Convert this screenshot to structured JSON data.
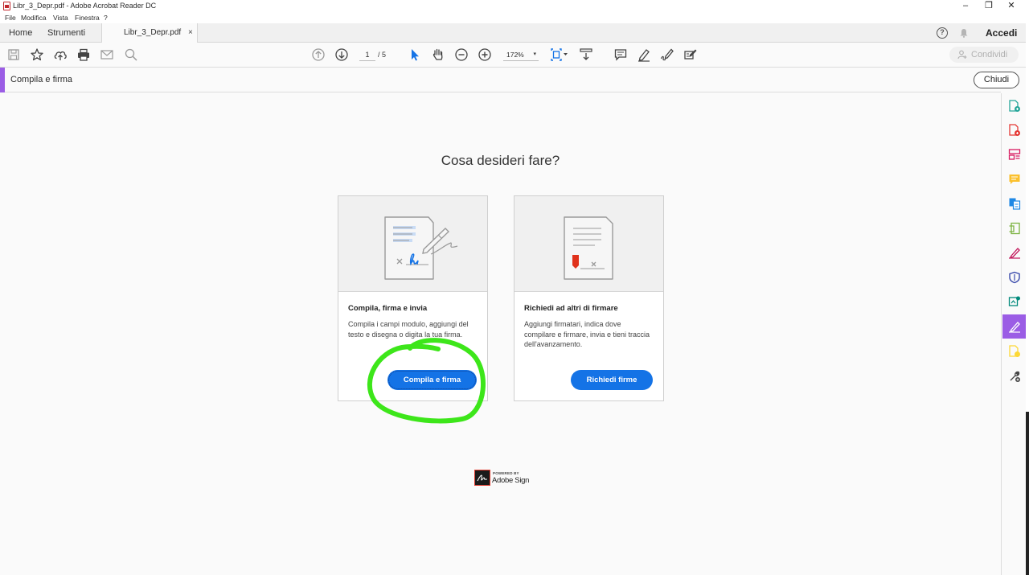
{
  "window": {
    "title": "Libr_3_Depr.pdf - Adobe Acrobat Reader DC",
    "controls": {
      "minimize": "–",
      "maximize": "❐",
      "close": "✕"
    }
  },
  "menu": [
    "File",
    "Modifica",
    "Vista",
    "Finestra",
    "?"
  ],
  "tabs": {
    "home": "Home",
    "tools": "Strumenti",
    "document": "Libr_3_Depr.pdf",
    "close": "×"
  },
  "account": {
    "signin": "Accedi",
    "help": "?"
  },
  "toolbar": {
    "page_current": "1",
    "page_total": "/ 5",
    "zoom": "172%",
    "zoom_caret": "▾",
    "share_label": "Condividi"
  },
  "panel": {
    "title": "Compila e firma",
    "close_label": "Chiudi"
  },
  "main": {
    "heading": "Cosa desideri fare?",
    "cards": [
      {
        "title": "Compila, firma e invia",
        "description": "Compila i campi modulo, aggiungi del testo e disegna o digita la tua firma.",
        "button": "Compila e firma"
      },
      {
        "title": "Richiedi ad altri di firmare",
        "description": "Aggiungi firmatari, indica dove compilare e firmare, invia e tieni traccia dell'avanzamento.",
        "button": "Richiedi firme"
      }
    ],
    "powered_small": "POWERED BY",
    "powered_brand": "Adobe Sign"
  },
  "colors": {
    "accent_purple": "#9b5de5",
    "primary_blue": "#1473e6",
    "annotation_green": "#3de61a",
    "pdf_red": "#c1272d"
  },
  "right_tools": [
    "create-pdf-icon",
    "export-pdf-icon",
    "organize-pages-icon",
    "comment-icon",
    "send-for-review-icon",
    "edit-pdf-icon",
    "fill-sign-tool-icon",
    "protect-icon",
    "enhance-scans-icon",
    "fill-sign-active-icon",
    "send-track-icon",
    "more-tools-icon"
  ]
}
